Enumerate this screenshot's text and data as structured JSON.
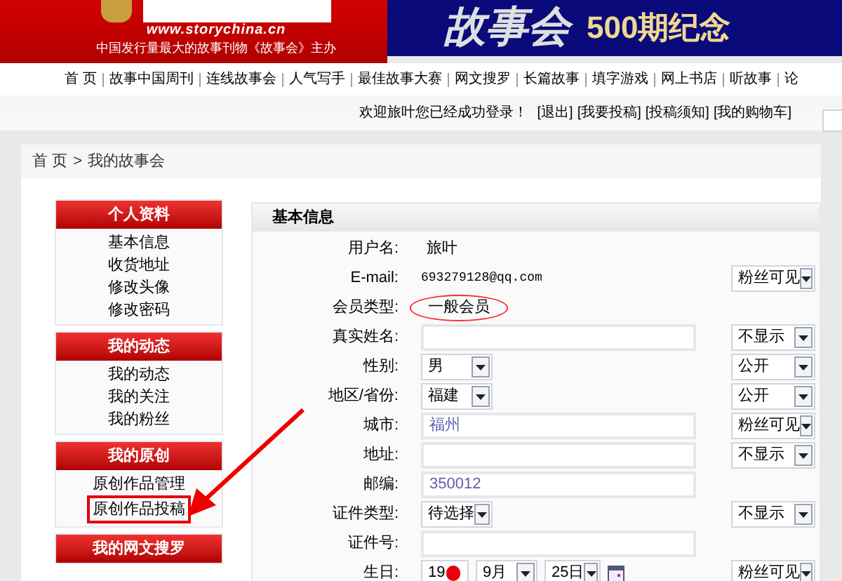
{
  "header": {
    "site_url": "www.storychina.cn",
    "tagline": "中国发行量最大的故事刊物《故事会》主办",
    "banner_title": "故事会",
    "banner_subtitle": "500期纪念"
  },
  "nav": [
    "首 页",
    "故事中国周刊",
    "连线故事会",
    "人气写手",
    "最佳故事大赛",
    "网文搜罗",
    "长篇故事",
    "填字游戏",
    "网上书店",
    "听故事",
    "论"
  ],
  "login_bar": {
    "welcome": "欢迎旅叶您已经成功登录！",
    "links": [
      "[退出]",
      "[我要投稿]",
      "[投稿须知]",
      "[我的购物车]"
    ]
  },
  "breadcrumb": {
    "items": [
      "首 页",
      "我的故事会"
    ],
    "separator": ">"
  },
  "sidebar": [
    {
      "title": "个人资料",
      "items": [
        {
          "label": "基本信息",
          "highlighted": false
        },
        {
          "label": "收货地址",
          "highlighted": false
        },
        {
          "label": "修改头像",
          "highlighted": false
        },
        {
          "label": "修改密码",
          "highlighted": false
        }
      ]
    },
    {
      "title": "我的动态",
      "items": [
        {
          "label": "我的动态",
          "highlighted": false
        },
        {
          "label": "我的关注",
          "highlighted": false
        },
        {
          "label": "我的粉丝",
          "highlighted": false
        }
      ]
    },
    {
      "title": "我的原创",
      "items": [
        {
          "label": "原创作品管理",
          "highlighted": false
        },
        {
          "label": "原创作品投稿",
          "highlighted": true
        }
      ]
    },
    {
      "title": "我的网文搜罗"
    }
  ],
  "form": {
    "title": "基本信息",
    "rows": [
      {
        "label": "用户名:",
        "kind": "text",
        "value": "旅叶",
        "circled": false
      },
      {
        "label": "E-mail:",
        "kind": "mono",
        "value": "693279128@qq.com",
        "circled": false,
        "privacy": "粉丝可见"
      },
      {
        "label": "会员类型:",
        "kind": "text",
        "value": "一般会员",
        "circled": true
      },
      {
        "label": "真实姓名:",
        "kind": "input",
        "privacy": "不显示"
      },
      {
        "label": "性别:",
        "kind": "select",
        "value": "男",
        "privacy": "公开"
      },
      {
        "label": "地区/省份:",
        "kind": "select",
        "value": "福建",
        "privacy": "公开"
      },
      {
        "label": "城市:",
        "kind": "input",
        "value": "福州",
        "privacy": "粉丝可见"
      },
      {
        "label": "地址:",
        "kind": "input",
        "privacy": "不显示"
      },
      {
        "label": "邮编:",
        "kind": "input",
        "value": "350012"
      },
      {
        "label": "证件类型:",
        "kind": "select",
        "value": "待选择",
        "privacy": "不显示"
      },
      {
        "label": "证件号:",
        "kind": "input"
      },
      {
        "label": "生日:",
        "kind": "date",
        "value": "19",
        "month": "9月",
        "day": "25日",
        "privacy": "粉丝可见"
      }
    ]
  }
}
